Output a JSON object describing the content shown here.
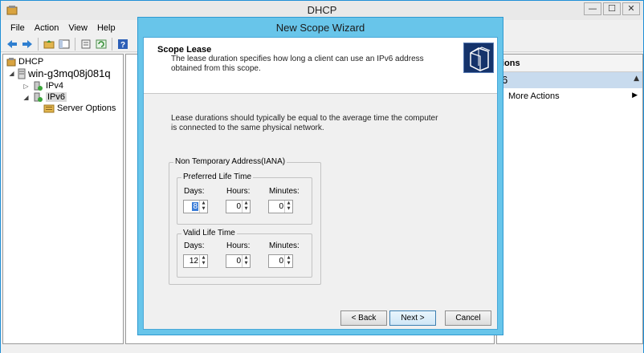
{
  "main_window": {
    "title": "DHCP",
    "controls": {
      "minimize": "—",
      "maximize": "☐",
      "close": "✕"
    }
  },
  "menu": [
    "File",
    "Action",
    "View",
    "Help"
  ],
  "toolbar": {
    "icons": [
      "back-icon",
      "forward-icon",
      "up-folder-icon",
      "show-tree-icon",
      "properties-icon",
      "refresh-icon",
      "help-icon"
    ]
  },
  "tree": {
    "root": "DHCP",
    "server": "win-g3mq08j081q",
    "ipv4": "IPv4",
    "ipv6": "IPv6",
    "server_options": "Server Options"
  },
  "actions": {
    "header": "ions",
    "section": "6",
    "more_actions": "More Actions"
  },
  "wizard": {
    "title": "New Scope Wizard",
    "header_title": "Scope Lease",
    "header_description": "The lease duration specifies how long a client can use an IPv6 address obtained from this scope.",
    "info": "Lease durations should typically be equal to the average time the computer is connected to the same physical network.",
    "group_iana": "Non Temporary Address(IANA)",
    "preferred": {
      "legend": "Preferred Life Time",
      "days_label": "Days:",
      "hours_label": "Hours:",
      "minutes_label": "Minutes:",
      "days": "8",
      "hours": "0",
      "minutes": "0"
    },
    "valid": {
      "legend": "Valid Life Time",
      "days_label": "Days:",
      "hours_label": "Hours:",
      "minutes_label": "Minutes:",
      "days": "12",
      "hours": "0",
      "minutes": "0"
    },
    "buttons": {
      "back": "< Back",
      "next": "Next >",
      "cancel": "Cancel"
    }
  }
}
